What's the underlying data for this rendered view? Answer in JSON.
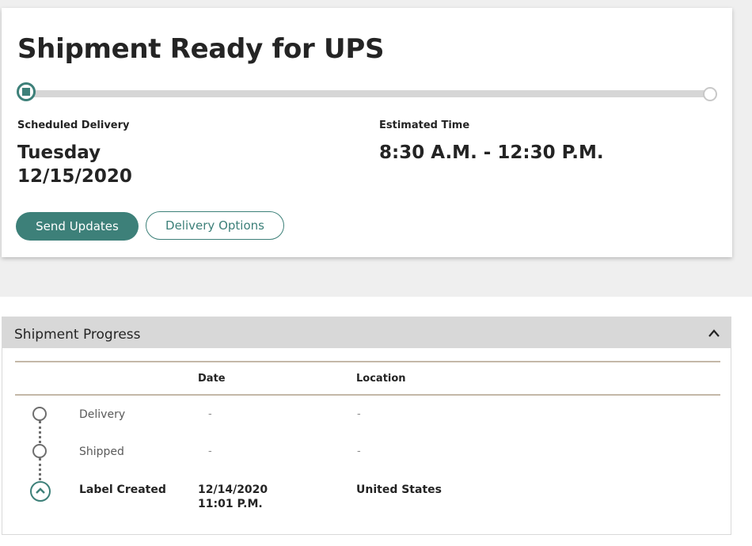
{
  "summary": {
    "title": "Shipment Ready for UPS",
    "scheduled_label": "Scheduled Delivery",
    "scheduled_day": "Tuesday",
    "scheduled_date": "12/15/2020",
    "estimated_label": "Estimated Time",
    "estimated_time": "8:30 A.M. - 12:30 P.M.",
    "send_updates_label": "Send Updates",
    "delivery_options_label": "Delivery Options"
  },
  "progress_bar": {
    "completed_fraction": 0.0,
    "accent_color": "#3d8079"
  },
  "progress_panel": {
    "title": "Shipment Progress",
    "columns": {
      "date": "Date",
      "location": "Location"
    },
    "rows": [
      {
        "status": "Delivery",
        "date": "-",
        "time": "",
        "location": "-"
      },
      {
        "status": "Shipped",
        "date": "-",
        "time": "",
        "location": "-"
      },
      {
        "status": "Label Created",
        "date": "12/14/2020",
        "time": "11:01 P.M.",
        "location": "United States"
      }
    ]
  },
  "icons": {
    "collapse": "chevron-up-icon",
    "current_step": "chevron-up-circle-icon"
  }
}
